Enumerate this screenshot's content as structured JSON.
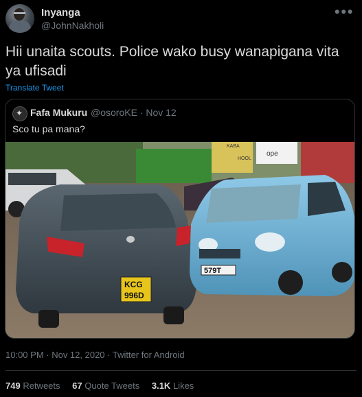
{
  "author": {
    "name": "Inyanga",
    "handle": "@JohnNakholi"
  },
  "menu_icon": "more-icon",
  "tweet": {
    "text": "Hii unaita scouts. Police wako busy wanapigana vita ya ufisadi",
    "translate_label": "Translate Tweet"
  },
  "quoted": {
    "name": "Fafa Mukuru",
    "meta": "@osoroKE · Nov 12",
    "text": "Sco tu pa mana?",
    "image": {
      "left_plate": [
        "KCG",
        "996D"
      ],
      "right_plate": "579T",
      "sign_text": [
        "ope",
        "KABA",
        "HOOL"
      ]
    }
  },
  "footer": {
    "timestamp": "10:00 PM · Nov 12, 2020 · Twitter for Android",
    "retweets_count": "749",
    "retweets_label": "Retweets",
    "quotes_count": "67",
    "quotes_label": "Quote Tweets",
    "likes_count": "3.1K",
    "likes_label": "Likes"
  },
  "colors": {
    "background": "#000000",
    "text": "#d9d9d9",
    "muted": "#6e767d",
    "link": "#1d9bf0",
    "border": "#2f3336"
  }
}
